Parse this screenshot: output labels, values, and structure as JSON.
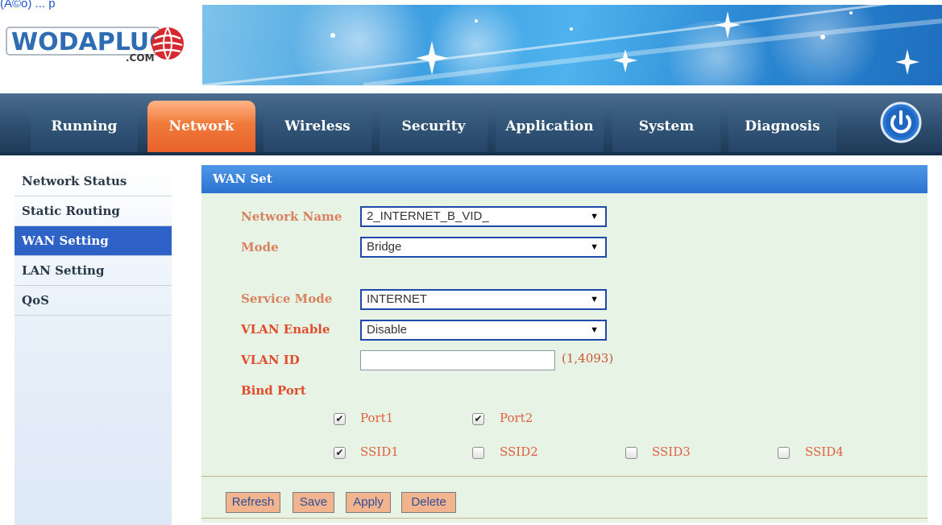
{
  "top_link": "(Ã©o) ... p",
  "logo": {
    "text": "WODAPLUG",
    "sub": ".COM"
  },
  "nav": {
    "tabs": [
      {
        "label": "Running"
      },
      {
        "label": "Network"
      },
      {
        "label": "Wireless"
      },
      {
        "label": "Security"
      },
      {
        "label": "Application"
      },
      {
        "label": "System"
      },
      {
        "label": "Diagnosis"
      }
    ],
    "active": "Network",
    "power_icon": "power-icon"
  },
  "sidebar": {
    "items": [
      {
        "label": "Network Status"
      },
      {
        "label": "Static Routing"
      },
      {
        "label": "WAN Setting"
      },
      {
        "label": "LAN Setting"
      },
      {
        "label": "QoS"
      }
    ],
    "active": "WAN Setting"
  },
  "panel": {
    "title": "WAN Set",
    "fields": {
      "network_name": {
        "label": "Network Name",
        "value": "2_INTERNET_B_VID_"
      },
      "mode": {
        "label": "Mode",
        "value": "Bridge"
      },
      "service_mode": {
        "label": "Service Mode",
        "value": "INTERNET"
      },
      "vlan_enable": {
        "label": "VLAN Enable",
        "value": "Disable"
      },
      "vlan_id": {
        "label": "VLAN ID",
        "value": "",
        "hint": "(1,4093)"
      },
      "bind_port": {
        "label": "Bind Port"
      }
    },
    "ports": [
      {
        "label": "Port1",
        "checked": true
      },
      {
        "label": "Port2",
        "checked": true
      }
    ],
    "ssids": [
      {
        "label": "SSID1",
        "checked": true
      },
      {
        "label": "SSID2",
        "checked": false
      },
      {
        "label": "SSID3",
        "checked": false
      },
      {
        "label": "SSID4",
        "checked": false
      }
    ],
    "buttons": {
      "refresh": "Refresh",
      "save": "Save",
      "apply": "Apply",
      "delete": "Delete"
    }
  },
  "colors": {
    "nav_bar": "#2f4f70",
    "active_tab": "#f07a3a",
    "sidebar_active": "#2f62c7",
    "panel_bg": "#e7f3e5",
    "panel_header": "#3a82db",
    "label": "#e04d2b",
    "button": "#f2b48e"
  }
}
